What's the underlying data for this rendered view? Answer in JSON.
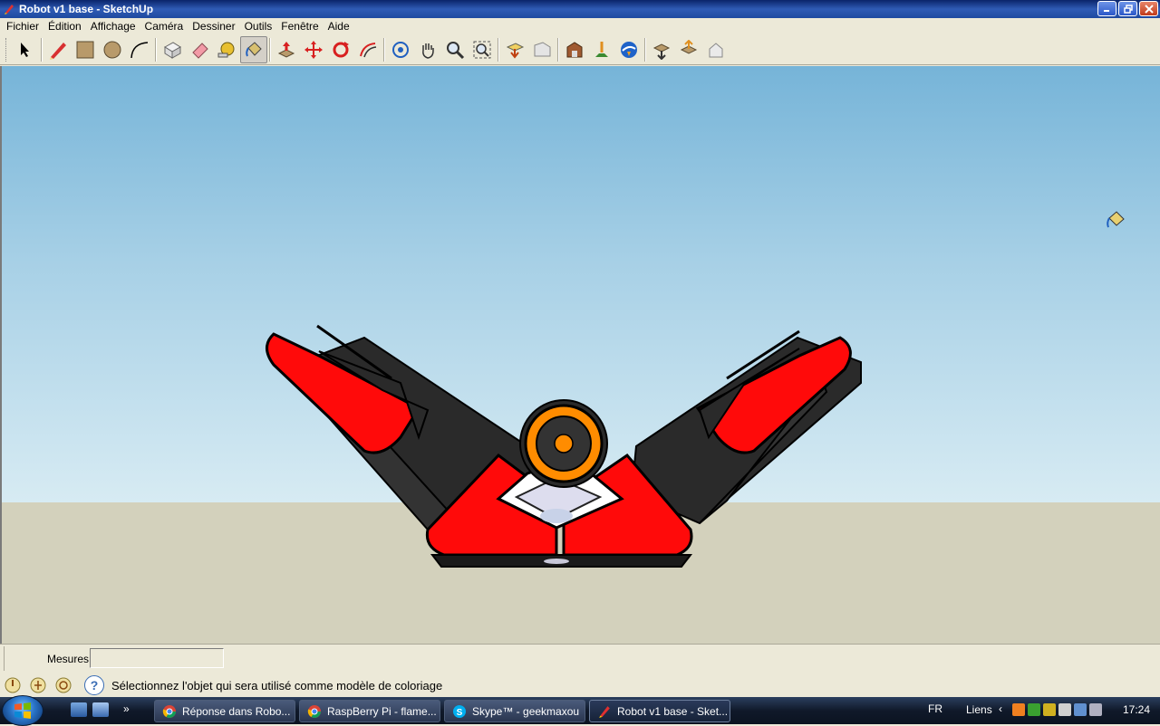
{
  "window": {
    "title": "Robot v1 base - SketchUp",
    "buttons": [
      "minimize-icon",
      "maximize-icon",
      "close-icon"
    ]
  },
  "menu": [
    "Fichier",
    "Édition",
    "Affichage",
    "Caméra",
    "Dessiner",
    "Outils",
    "Fenêtre",
    "Aide"
  ],
  "toolbar": {
    "tools": [
      {
        "name": "select-tool-icon",
        "group": 1
      },
      {
        "name": "pencil-tool-icon",
        "group": 2
      },
      {
        "name": "rectangle-tool-icon",
        "group": 2
      },
      {
        "name": "circle-tool-icon",
        "group": 2
      },
      {
        "name": "arc-tool-icon",
        "group": 2
      },
      {
        "name": "make-component-icon",
        "group": 3
      },
      {
        "name": "eraser-tool-icon",
        "group": 3
      },
      {
        "name": "tape-measure-icon",
        "group": 3
      },
      {
        "name": "paint-bucket-icon",
        "group": 3,
        "active": true
      },
      {
        "name": "push-pull-icon",
        "group": 4
      },
      {
        "name": "move-tool-icon",
        "group": 4
      },
      {
        "name": "rotate-tool-icon",
        "group": 4
      },
      {
        "name": "offset-tool-icon",
        "group": 4
      },
      {
        "name": "orbit-tool-icon",
        "group": 5
      },
      {
        "name": "pan-tool-icon",
        "group": 5
      },
      {
        "name": "zoom-tool-icon",
        "group": 5
      },
      {
        "name": "zoom-extents-icon",
        "group": 5
      },
      {
        "name": "previous-view-icon",
        "group": 6
      },
      {
        "name": "next-view-icon",
        "group": 6
      },
      {
        "name": "warehouse-icon",
        "group": 7
      },
      {
        "name": "add-location-icon",
        "group": 7
      },
      {
        "name": "google-earth-icon",
        "group": 7
      },
      {
        "name": "get-models-icon",
        "group": 8
      },
      {
        "name": "share-model-icon",
        "group": 8
      },
      {
        "name": "share-component-icon",
        "group": 8
      }
    ]
  },
  "colors": {
    "sky_top": "#76b4d8",
    "ground": "#d3d1bc",
    "robot_red": "#ff0a0a",
    "robot_black": "#2a2a2a",
    "wheel_orange": "#ff8c00"
  },
  "measures": {
    "label": "Mesures",
    "value": ""
  },
  "status": {
    "icons": [
      "geolocation-icon",
      "credits-icon",
      "user-icon"
    ],
    "help_icon": "help-icon",
    "help_glyph": "?",
    "text": "Sélectionnez l'objet qui sera utilisé comme modèle de coloriage"
  },
  "taskbar": {
    "tasks": [
      {
        "label": "Réponse dans Robo...",
        "icon": "chrome-icon"
      },
      {
        "label": "RaspBerry Pi - flame...",
        "icon": "chrome-icon"
      },
      {
        "label": "Skype™ - geekmaxou",
        "icon": "skype-icon"
      },
      {
        "label": "Robot v1 base - Sket...",
        "icon": "sketchup-icon",
        "active": true
      }
    ],
    "language": "FR",
    "links": "Liens",
    "clock": "17:24"
  }
}
